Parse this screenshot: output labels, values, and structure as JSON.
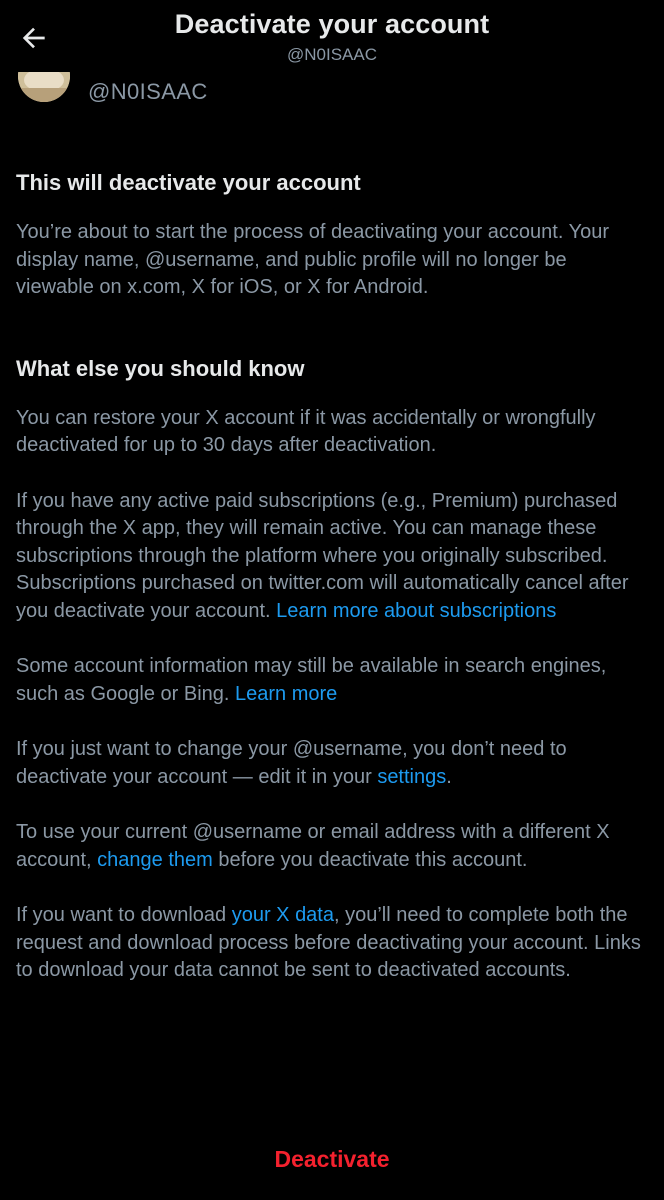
{
  "header": {
    "title": "Deactivate your account",
    "subtitle": "@N0ISAAC",
    "back_icon": "arrow-left-icon"
  },
  "account": {
    "handle": "@N0ISAAC"
  },
  "section1": {
    "title": "This will deactivate your account",
    "body": "You’re about to start the process of deactivating your account. Your display name, @username, and public profile will no longer be viewable on x.com, X for iOS, or X for Android."
  },
  "section2": {
    "title": "What else you should know",
    "p1": "You can restore your X account if it was accidentally or wrongfully deactivated for up to 30 days after deactivation.",
    "p2_text": "If you have any active paid subscriptions (e.g., Premium) purchased through the X app, they will remain active. You can manage these subscriptions through the platform where you originally subscribed. Subscriptions purchased on twitter.com will automatically cancel after you deactivate your account.",
    "p2_link": "Learn more about subscriptions",
    "p3_text": "Some account information may still be available in search engines, such as Google or Bing.",
    "p3_link": "Learn more",
    "p4_text": "If you just want to change your @username, you don’t need to deactivate your account — edit it in your",
    "p4_link": "settings",
    "p4_end": ".",
    "p5_text": "To use your current @username or email address with a different X account,",
    "p5_link": "change them",
    "p5_end": "before you deactivate this account.",
    "p6_text": "If you want to download",
    "p6_link": "your X data",
    "p6_end": ", you’ll need to complete both the request and download process before deactivating your account. Links to download your data cannot be sent to deactivated accounts."
  },
  "footer": {
    "deactivate_label": "Deactivate"
  },
  "colors": {
    "background": "#000000",
    "text_primary": "#e7e9ea",
    "text_secondary": "#8b98a5",
    "link": "#1d9bf0",
    "danger": "#f4212e"
  }
}
